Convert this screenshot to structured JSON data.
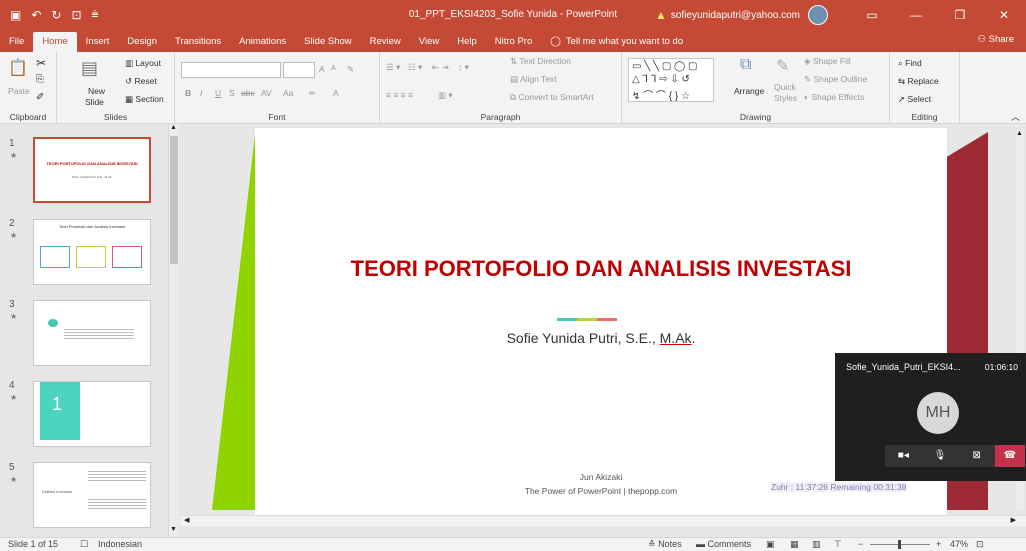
{
  "window": {
    "title": "01_PPT_EKSI4203_Sofie Yunida - PowerPoint",
    "account": "sofieyunidaputri@yahoo.com",
    "icons": [
      "save-icon",
      "undo-icon",
      "redo-icon",
      "present-icon",
      "customize-icon"
    ]
  },
  "tabs": [
    "File",
    "Home",
    "Insert",
    "Design",
    "Transitions",
    "Animations",
    "Slide Show",
    "Review",
    "View",
    "Help",
    "Nitro Pro"
  ],
  "active_tab": "Home",
  "tell_me": "Tell me what you want to do",
  "share": "Share",
  "ribbon": {
    "clipboard": {
      "label": "Clipboard",
      "paste": "Paste"
    },
    "slides": {
      "label": "Slides",
      "new_slide_1": "New",
      "new_slide_2": "Slide",
      "layout": "Layout",
      "reset": "Reset",
      "section": "Section"
    },
    "font": {
      "label": "Font",
      "bold": "B",
      "italic": "I",
      "underline": "U",
      "strike": "S",
      "abc": "abc",
      "spacing": "AV",
      "case": "Aa",
      "grow": "A",
      "shrink": "A"
    },
    "paragraph": {
      "label": "Paragraph",
      "text_direction": "Text Direction",
      "align_text": "Align Text",
      "smartart": "Convert to SmartArt"
    },
    "drawing": {
      "label": "Drawing",
      "arrange": "Arrange",
      "quick_1": "Quick",
      "quick_2": "Styles",
      "fill": "Shape Fill",
      "outline": "Shape Outline",
      "effects": "Shape Effects"
    },
    "editing": {
      "label": "Editing",
      "find": "Find",
      "replace": "Replace",
      "select": "Select"
    }
  },
  "slides_panel": [
    {
      "num": "1",
      "star": "★",
      "title": "TEORI PORTOFOLIO DAN ANALISIS INVESTASI",
      "sub": "Sofie Yunida Putri, S.E., M.Ak."
    },
    {
      "num": "2",
      "star": "★",
      "title": "Teori Portofolio dan Analisis Investasi"
    },
    {
      "num": "3",
      "star": "★"
    },
    {
      "num": "4",
      "star": "★",
      "big": "1"
    },
    {
      "num": "5",
      "star": "★",
      "title": "Definisi Investasi"
    }
  ],
  "slide": {
    "title": "TEORI PORTOFOLIO DAN ANALISIS INVESTASI",
    "author_plain": "Sofie Yunida Putri, S.E., ",
    "author_u": "M.Ak",
    "author_end": ".",
    "footer_1": "Jun Akizaki",
    "footer_2": "The Power of PowerPoint | thepopp.com",
    "timer": "Zuhr : 11:37:26 Remaining 00:31:38"
  },
  "call": {
    "name": "Sofie_Yunida_Putri_EKSI4...",
    "time": "01:06:10",
    "initials": "MH"
  },
  "status": {
    "slide": "Slide 1 of 15",
    "language": "Indonesian",
    "notes": "Notes",
    "comments": "Comments",
    "zoom": "47%"
  },
  "colors": {
    "accent": "#c44a35",
    "title_red": "#c00000",
    "green": "#8fd400",
    "maroon": "#9e2a35"
  }
}
